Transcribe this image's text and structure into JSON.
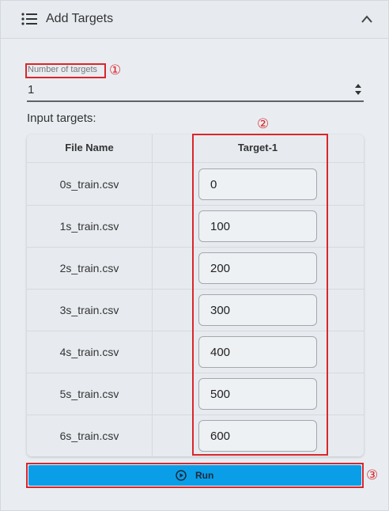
{
  "header": {
    "title": "Add Targets",
    "menu_icon": "list-icon",
    "collapse_icon": "chevron-up-icon"
  },
  "number_of_targets": {
    "label": "Number of targets",
    "value": "1",
    "marker": "①"
  },
  "input_targets": {
    "title": "Input targets:",
    "marker": "②"
  },
  "table": {
    "columns": [
      "File Name",
      "Target-1"
    ],
    "rows": [
      {
        "file": "0s_train.csv",
        "target": "0"
      },
      {
        "file": "1s_train.csv",
        "target": "100"
      },
      {
        "file": "2s_train.csv",
        "target": "200"
      },
      {
        "file": "3s_train.csv",
        "target": "300"
      },
      {
        "file": "4s_train.csv",
        "target": "400"
      },
      {
        "file": "5s_train.csv",
        "target": "500"
      },
      {
        "file": "6s_train.csv",
        "target": "600"
      }
    ]
  },
  "run": {
    "label": "Run",
    "icon": "play-circle-icon",
    "marker": "③"
  },
  "colors": {
    "accent": "#0a9ee8",
    "highlight": "#d9262c",
    "background": "#e9edf1"
  }
}
